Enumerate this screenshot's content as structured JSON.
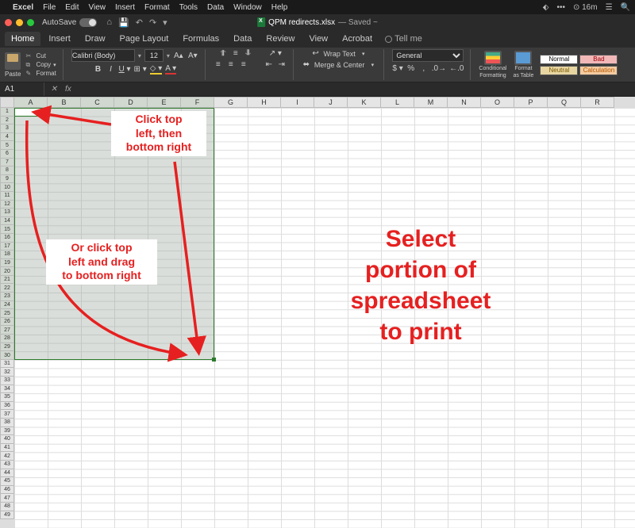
{
  "mac_menu": {
    "app": "Excel",
    "items": [
      "File",
      "Edit",
      "View",
      "Insert",
      "Format",
      "Tools",
      "Data",
      "Window",
      "Help"
    ],
    "right": {
      "dropbox": "⬖",
      "more": "•••",
      "timer": "⊙ 16m",
      "control": "☰",
      "search": "🔍"
    }
  },
  "title_bar": {
    "autosave_label": "AutoSave",
    "doc_name": "QPM redirects.xlsx",
    "doc_status": "— Saved ~"
  },
  "ribbon_tabs": [
    "Home",
    "Insert",
    "Draw",
    "Page Layout",
    "Formulas",
    "Data",
    "Review",
    "View",
    "Acrobat"
  ],
  "ribbon_active_tab": "Home",
  "tell_me": "Tell me",
  "ribbon": {
    "paste": "Paste",
    "cut": "Cut",
    "copy": "Copy",
    "format_painter": "Format",
    "font_name": "Calibri (Body)",
    "font_size": "12",
    "wrap_text": "Wrap Text",
    "merge_center": "Merge & Center",
    "number_format": "General",
    "cond_fmt_line1": "Conditional",
    "cond_fmt_line2": "Formatting",
    "fmt_table_line1": "Format",
    "fmt_table_line2": "as Table",
    "styles": {
      "normal": "Normal",
      "bad": "Bad",
      "neutral": "Neutral",
      "calc": "Calculation"
    }
  },
  "name_box": "A1",
  "columns": [
    "A",
    "B",
    "C",
    "D",
    "E",
    "F",
    "G",
    "H",
    "I",
    "J",
    "K",
    "L",
    "M",
    "N",
    "O",
    "P",
    "Q",
    "R"
  ],
  "selected_cols_count": 6,
  "rows_visible": 49,
  "selected_rows_count": 30,
  "selection": "A1:F30",
  "annotations": {
    "top_right": "Click top\nleft, then\nbottom right",
    "mid_left": "Or click top\nleft and drag\nto bottom right",
    "big": "Select\nportion of\nspreadsheet\nto print"
  }
}
